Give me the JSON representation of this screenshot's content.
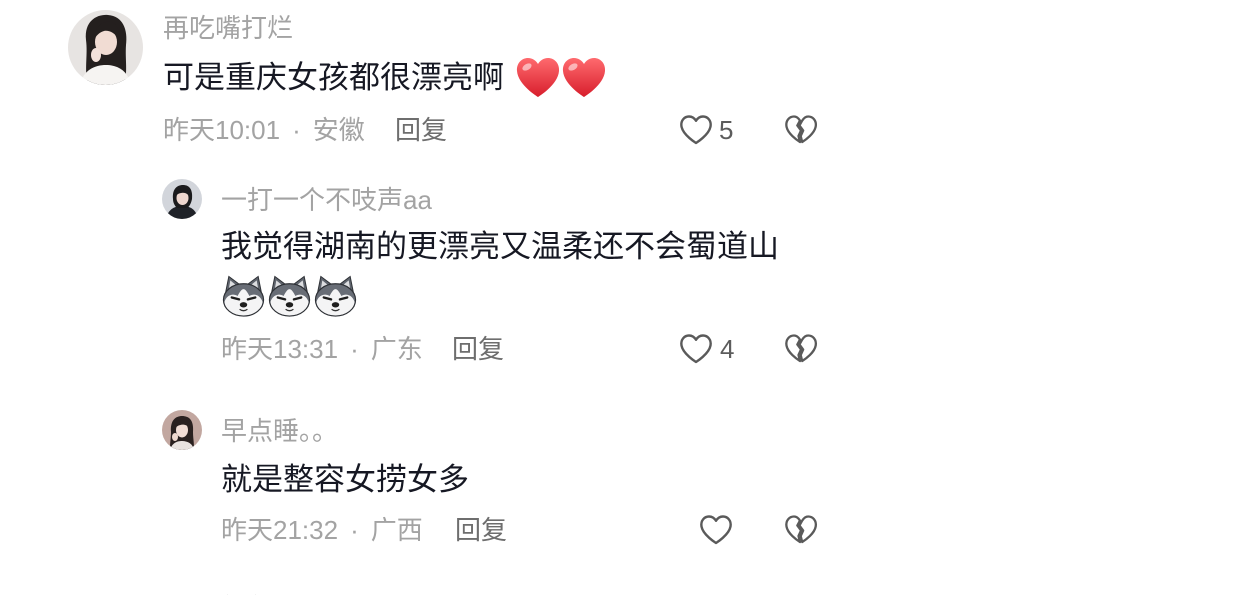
{
  "comments": [
    {
      "username": "再吃嘴打烂",
      "text": "可是重庆女孩都很漂亮啊",
      "emoji": [
        "red-heart-emoji",
        "red-heart-emoji"
      ],
      "time": "昨天10:01",
      "separator": "·",
      "location": "安徽",
      "reply_label": "回复",
      "like_count": "5"
    },
    {
      "username": "一打一个不吱声aa",
      "text": "我觉得湖南的更漂亮又温柔还不会蜀道山",
      "emoji": [
        "husky-emoji",
        "husky-emoji",
        "husky-emoji"
      ],
      "time": "昨天13:31",
      "separator": "·",
      "location": "广东",
      "reply_label": "回复",
      "like_count": "4"
    },
    {
      "username": "早点睡。。",
      "text": "就是整容女捞女多",
      "time": "昨天21:32",
      "separator": "·",
      "location": "广西",
      "reply_label": "回复"
    }
  ],
  "icons": {
    "like": "heart-outline-icon",
    "dislike": "broken-heart-icon",
    "avatar": "avatar-photo"
  },
  "colors": {
    "background": "#ffffff",
    "username": "#a3a3a3",
    "comment_text": "#161823",
    "meta": "#a3a3a3",
    "reply_action": "#6e6e6e",
    "icon_stroke": "#5a5a5a",
    "heart_emoji": "#e8202e"
  }
}
